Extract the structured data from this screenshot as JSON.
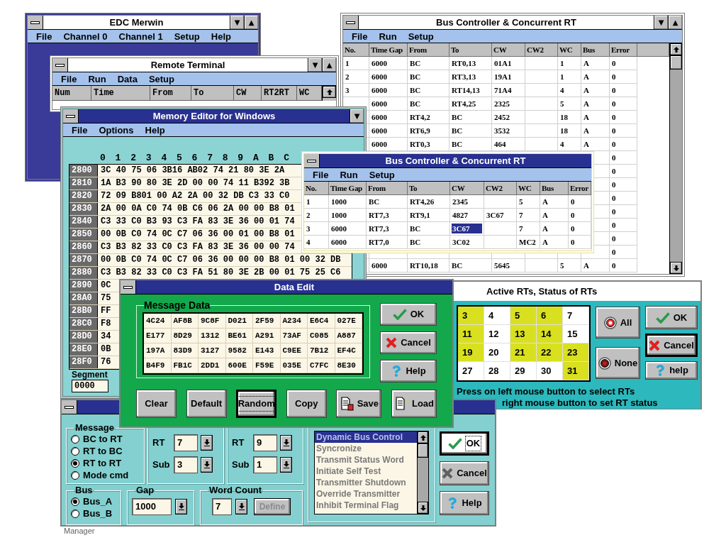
{
  "edc_window": {
    "title": "EDC Merwin",
    "active": false,
    "window_buttons": [
      "▼",
      "▲"
    ],
    "menu": [
      "File",
      "Channel 0",
      "Channel 1",
      "Setup",
      "Help"
    ]
  },
  "remote_terminal": {
    "title": "Remote Terminal",
    "active": false,
    "window_buttons": [
      "▼",
      "▲"
    ],
    "menu": [
      "File",
      "Run",
      "Data",
      "Setup"
    ],
    "columns": [
      "Num",
      "Time",
      "From",
      "To",
      "CW",
      "RT2RT",
      "WC"
    ]
  },
  "bus_controller": {
    "title": "Bus Controller & Concurrent RT",
    "active": false,
    "window_buttons": [
      "▼",
      "▲"
    ],
    "menu": [
      "File",
      "Run",
      "Setup"
    ],
    "columns": [
      "No.",
      "Time Gap",
      "From",
      "To",
      "CW",
      "CW2",
      "WC",
      "Bus",
      "Error"
    ],
    "rows": [
      [
        "1",
        "6000",
        "BC",
        "RT0,13",
        "01A1",
        null,
        "1",
        "A",
        "0"
      ],
      [
        "2",
        "6000",
        "BC",
        "RT3,13",
        "19A1",
        null,
        "1",
        "A",
        "0"
      ],
      [
        "3",
        "6000",
        "BC",
        "RT14,13",
        "71A4",
        null,
        "4",
        "A",
        "0"
      ],
      [
        null,
        "6000",
        "BC",
        "RT4,25",
        "2325",
        null,
        "5",
        "A",
        "0"
      ],
      [
        null,
        "6000",
        "RT4,2",
        "BC",
        "2452",
        null,
        "18",
        "A",
        "0"
      ],
      [
        null,
        "6000",
        "RT6,9",
        "BC",
        "3532",
        null,
        "18",
        "A",
        "0"
      ],
      [
        null,
        "6000",
        "RT0,3",
        "BC",
        "464",
        null,
        "4",
        "A",
        "0"
      ],
      [
        null,
        null,
        null,
        null,
        null,
        null,
        null,
        null,
        "0"
      ],
      [
        null,
        null,
        null,
        null,
        null,
        null,
        null,
        null,
        "0"
      ],
      [
        null,
        null,
        null,
        null,
        null,
        null,
        null,
        null,
        "0"
      ],
      [
        null,
        null,
        null,
        null,
        null,
        null,
        null,
        null,
        "0"
      ],
      [
        null,
        null,
        null,
        null,
        null,
        null,
        null,
        null,
        "0"
      ],
      [
        null,
        null,
        null,
        null,
        null,
        null,
        null,
        null,
        "0"
      ],
      [
        null,
        null,
        null,
        null,
        null,
        null,
        null,
        null,
        "0"
      ],
      [
        null,
        null,
        null,
        null,
        null,
        null,
        null,
        null,
        "0"
      ],
      [
        null,
        "6000",
        "RT10,18",
        "BC",
        "5645",
        null,
        "5",
        "A",
        "0"
      ]
    ]
  },
  "memory_editor": {
    "title": "Memory Editor for Windows",
    "active": true,
    "window_buttons": [
      "▼"
    ],
    "menu": [
      "File",
      "Options",
      "Help"
    ],
    "column_header": [
      "0",
      "1",
      "2",
      "3",
      "4",
      "5",
      "6",
      "7",
      "8",
      "9",
      "A",
      "B",
      "C"
    ],
    "rows": [
      {
        "address": "2800",
        "data": "3C 40 75 06 3B16 AB02 74 21 80 3E 2A"
      },
      {
        "address": "2810",
        "data": "1A B3 90 80 3E 2D 00 00 74 11 B392 3B"
      },
      {
        "address": "2820",
        "data": "72 09 B801 00 A2 2A 00 32 DB C3 33 C0"
      },
      {
        "address": "2830",
        "data": "2A 00 0A C0 74 0B C6 06 2A 00 00 B8 01"
      },
      {
        "address": "2840",
        "data": "C3 33 C0 B3 93 C3 FA 83 3E 36 00 01 74"
      },
      {
        "address": "2850",
        "data": "00 0B C0 74 0C C7 06 36 00 01 00 B8 01"
      },
      {
        "address": "2860",
        "data": "C3 B3 82 33 C0 C3 FA 83 3E 36 00 00 74"
      },
      {
        "address": "2870",
        "data": "00 0B C0 74 0C C7 06 36 00 00 00 B8 01 00 32 DB"
      },
      {
        "address": "2880",
        "data": "C3 B3 82 33 C0 C3 FA 51 80 3E 2B 00 01 75 25 C6"
      },
      {
        "address": "2890",
        "data": "0C"
      },
      {
        "address": "28A0",
        "data": "75"
      },
      {
        "address": "28B0",
        "data": "FF"
      },
      {
        "address": "28C0",
        "data": "F8"
      },
      {
        "address": "28D0",
        "data": "34"
      },
      {
        "address": "28E0",
        "data": "0B"
      },
      {
        "address": "28F0",
        "data": "76"
      }
    ],
    "segment": {
      "label": "Segment",
      "value": "0000"
    }
  },
  "bus_controller_child": {
    "title": "Bus Controller & Concurrent RT",
    "active": true,
    "menu": [
      "File",
      "Run",
      "Setup"
    ],
    "columns": [
      "No.",
      "Time Gap",
      "From",
      "To",
      "CW",
      "CW2",
      "WC",
      "Bus",
      "Error"
    ],
    "rows": [
      {
        "cells": [
          {
            "text": "1",
            "selected": false
          },
          {
            "text": "1000",
            "selected": false
          },
          {
            "text": "BC",
            "selected": false
          },
          {
            "text": "RT4,26",
            "selected": false
          },
          {
            "text": "2345",
            "selected": false
          },
          {
            "selected": false
          },
          {
            "text": "5",
            "selected": false
          },
          {
            "text": "A",
            "selected": false
          },
          {
            "text": "0",
            "selected": false
          }
        ]
      },
      {
        "cells": [
          {
            "text": "2",
            "selected": false
          },
          {
            "text": "1000",
            "selected": false
          },
          {
            "text": "RT7,3",
            "selected": false
          },
          {
            "text": "RT9,1",
            "selected": false
          },
          {
            "text": "4827",
            "selected": false
          },
          {
            "text": "3C67",
            "selected": false
          },
          {
            "text": "7",
            "selected": false
          },
          {
            "text": "A",
            "selected": false
          },
          {
            "text": "0",
            "selected": false
          }
        ]
      },
      {
        "cells": [
          {
            "text": "3",
            "selected": false
          },
          {
            "text": "6000",
            "selected": false
          },
          {
            "text": "RT7,3",
            "selected": false
          },
          {
            "text": "BC",
            "selected": false
          },
          {
            "text": "3C67",
            "selected": true
          },
          {
            "selected": false
          },
          {
            "text": "7",
            "selected": false
          },
          {
            "text": "A",
            "selected": false
          },
          {
            "text": "0",
            "selected": false
          }
        ]
      },
      {
        "cells": [
          {
            "text": "4",
            "selected": false
          },
          {
            "text": "6000",
            "selected": false
          },
          {
            "text": "RT7,0",
            "selected": false
          },
          {
            "text": "BC",
            "selected": false
          },
          {
            "text": "3C02",
            "selected": false
          },
          {
            "selected": false
          },
          {
            "text": "MC2",
            "selected": false
          },
          {
            "text": "A",
            "selected": false
          },
          {
            "text": "0",
            "selected": false
          }
        ]
      }
    ]
  },
  "data_edit": {
    "title": "Data Edit",
    "active": true,
    "group_label": "Message Data",
    "cells": [
      [
        "4C24",
        "AF8B",
        "9C8F",
        "D021",
        "2F59",
        "A234",
        "E6C4",
        "027E"
      ],
      [
        "E177",
        "8D29",
        "1312",
        "BE61",
        "A291",
        "73AF",
        "C085",
        "A887"
      ],
      [
        "197A",
        "83D9",
        "3127",
        "9582",
        "E143",
        "C9EE",
        "7B12",
        "EF4C"
      ],
      [
        "B4F9",
        "FB1C",
        "2DD1",
        "600E",
        "F59E",
        "035E",
        "C7FC",
        "8E30"
      ]
    ],
    "side_buttons": [
      {
        "label": "OK",
        "kind": "ok",
        "focused": false
      },
      {
        "label": "Cancel",
        "kind": "cancel",
        "focused": false
      },
      {
        "label": "Help",
        "kind": "help",
        "focused": false
      }
    ],
    "bottom_buttons": [
      {
        "label": "Clear",
        "kind": "plain",
        "focused": false
      },
      {
        "label": "Default",
        "kind": "plain",
        "focused": false
      },
      {
        "label": "Random",
        "kind": "plain",
        "focused": true
      },
      {
        "label": "Copy",
        "kind": "plain",
        "focused": false
      },
      {
        "label": "Save",
        "kind": "save",
        "focused": false
      },
      {
        "label": "Load",
        "kind": "load",
        "focused": false
      }
    ]
  },
  "active_rts": {
    "title": "Active RTs, Status of RTs",
    "cells": [
      {
        "label": "3",
        "selected": true
      },
      {
        "label": "4",
        "selected": false
      },
      {
        "label": "5",
        "selected": true
      },
      {
        "label": "6",
        "selected": true
      },
      {
        "label": "7",
        "selected": false
      },
      {
        "label": "11",
        "selected": true
      },
      {
        "label": "12",
        "selected": false
      },
      {
        "label": "13",
        "selected": true
      },
      {
        "label": "14",
        "selected": true
      },
      {
        "label": "15",
        "selected": false
      },
      {
        "label": "19",
        "selected": true
      },
      {
        "label": "20",
        "selected": false
      },
      {
        "label": "21",
        "selected": true
      },
      {
        "label": "22",
        "selected": true
      },
      {
        "label": "23",
        "selected": true
      },
      {
        "label": "27",
        "selected": false
      },
      {
        "label": "28",
        "selected": false
      },
      {
        "label": "29",
        "selected": false
      },
      {
        "label": "30",
        "selected": false
      },
      {
        "label": "31",
        "selected": true
      }
    ],
    "select_buttons": [
      {
        "label": "All",
        "kind": "all",
        "default": false
      },
      {
        "label": "None",
        "kind": "none",
        "default": false
      }
    ],
    "buttons": [
      {
        "label": "OK",
        "kind": "ok",
        "default": false
      },
      {
        "label": "Cancel",
        "kind": "cancel",
        "default": true
      },
      {
        "label": "help",
        "kind": "help",
        "default": false
      }
    ],
    "hint_lines": [
      "Press on left mouse button to select RTs",
      "right mouse button to set RT status"
    ]
  },
  "rt_dialog": {
    "active": true,
    "message_group": {
      "label": "Message",
      "options": [
        {
          "label": "BC to RT",
          "selected": false
        },
        {
          "label": "RT to BC",
          "selected": false
        },
        {
          "label": "RT to RT",
          "selected": true
        },
        {
          "label": "Mode cmd",
          "selected": false
        }
      ]
    },
    "rt_groups": [
      {
        "fields": [
          {
            "label": "RT",
            "value": "7"
          },
          {
            "label": "Sub",
            "value": "3"
          }
        ]
      },
      {
        "fields": [
          {
            "label": "RT",
            "value": "9"
          },
          {
            "label": "Sub",
            "value": "1"
          }
        ]
      }
    ],
    "bus_group": {
      "label": "Bus",
      "options": [
        {
          "label": "Bus_A",
          "selected": true
        },
        {
          "label": "Bus_B",
          "selected": false
        }
      ]
    },
    "gap_group": {
      "label": "Gap",
      "value": "1000"
    },
    "word_count_group": {
      "label": "Word Count",
      "value": "7",
      "button": {
        "label": "Define",
        "disabled": true
      }
    },
    "mode_list": {
      "items": [
        {
          "label": "Dynamic Bus Control",
          "selected": true
        },
        {
          "label": "Syncronize",
          "selected": false
        },
        {
          "label": "Transmit Status Word",
          "selected": false
        },
        {
          "label": "Initiate Self Test",
          "selected": false
        },
        {
          "label": "Transmitter Shutdown",
          "selected": false
        },
        {
          "label": "Override Transmitter",
          "selected": false
        },
        {
          "label": "Inhibit Terminal Flag",
          "selected": false
        }
      ]
    },
    "buttons": [
      {
        "label": "OK",
        "kind": "ok",
        "focused": true,
        "pressed": true
      },
      {
        "label": "Cancel",
        "kind": "cancel",
        "focused": false,
        "pressed": false
      },
      {
        "label": "Help",
        "kind": "help",
        "focused": false,
        "pressed": false
      }
    ]
  },
  "background_text": "Manager"
}
